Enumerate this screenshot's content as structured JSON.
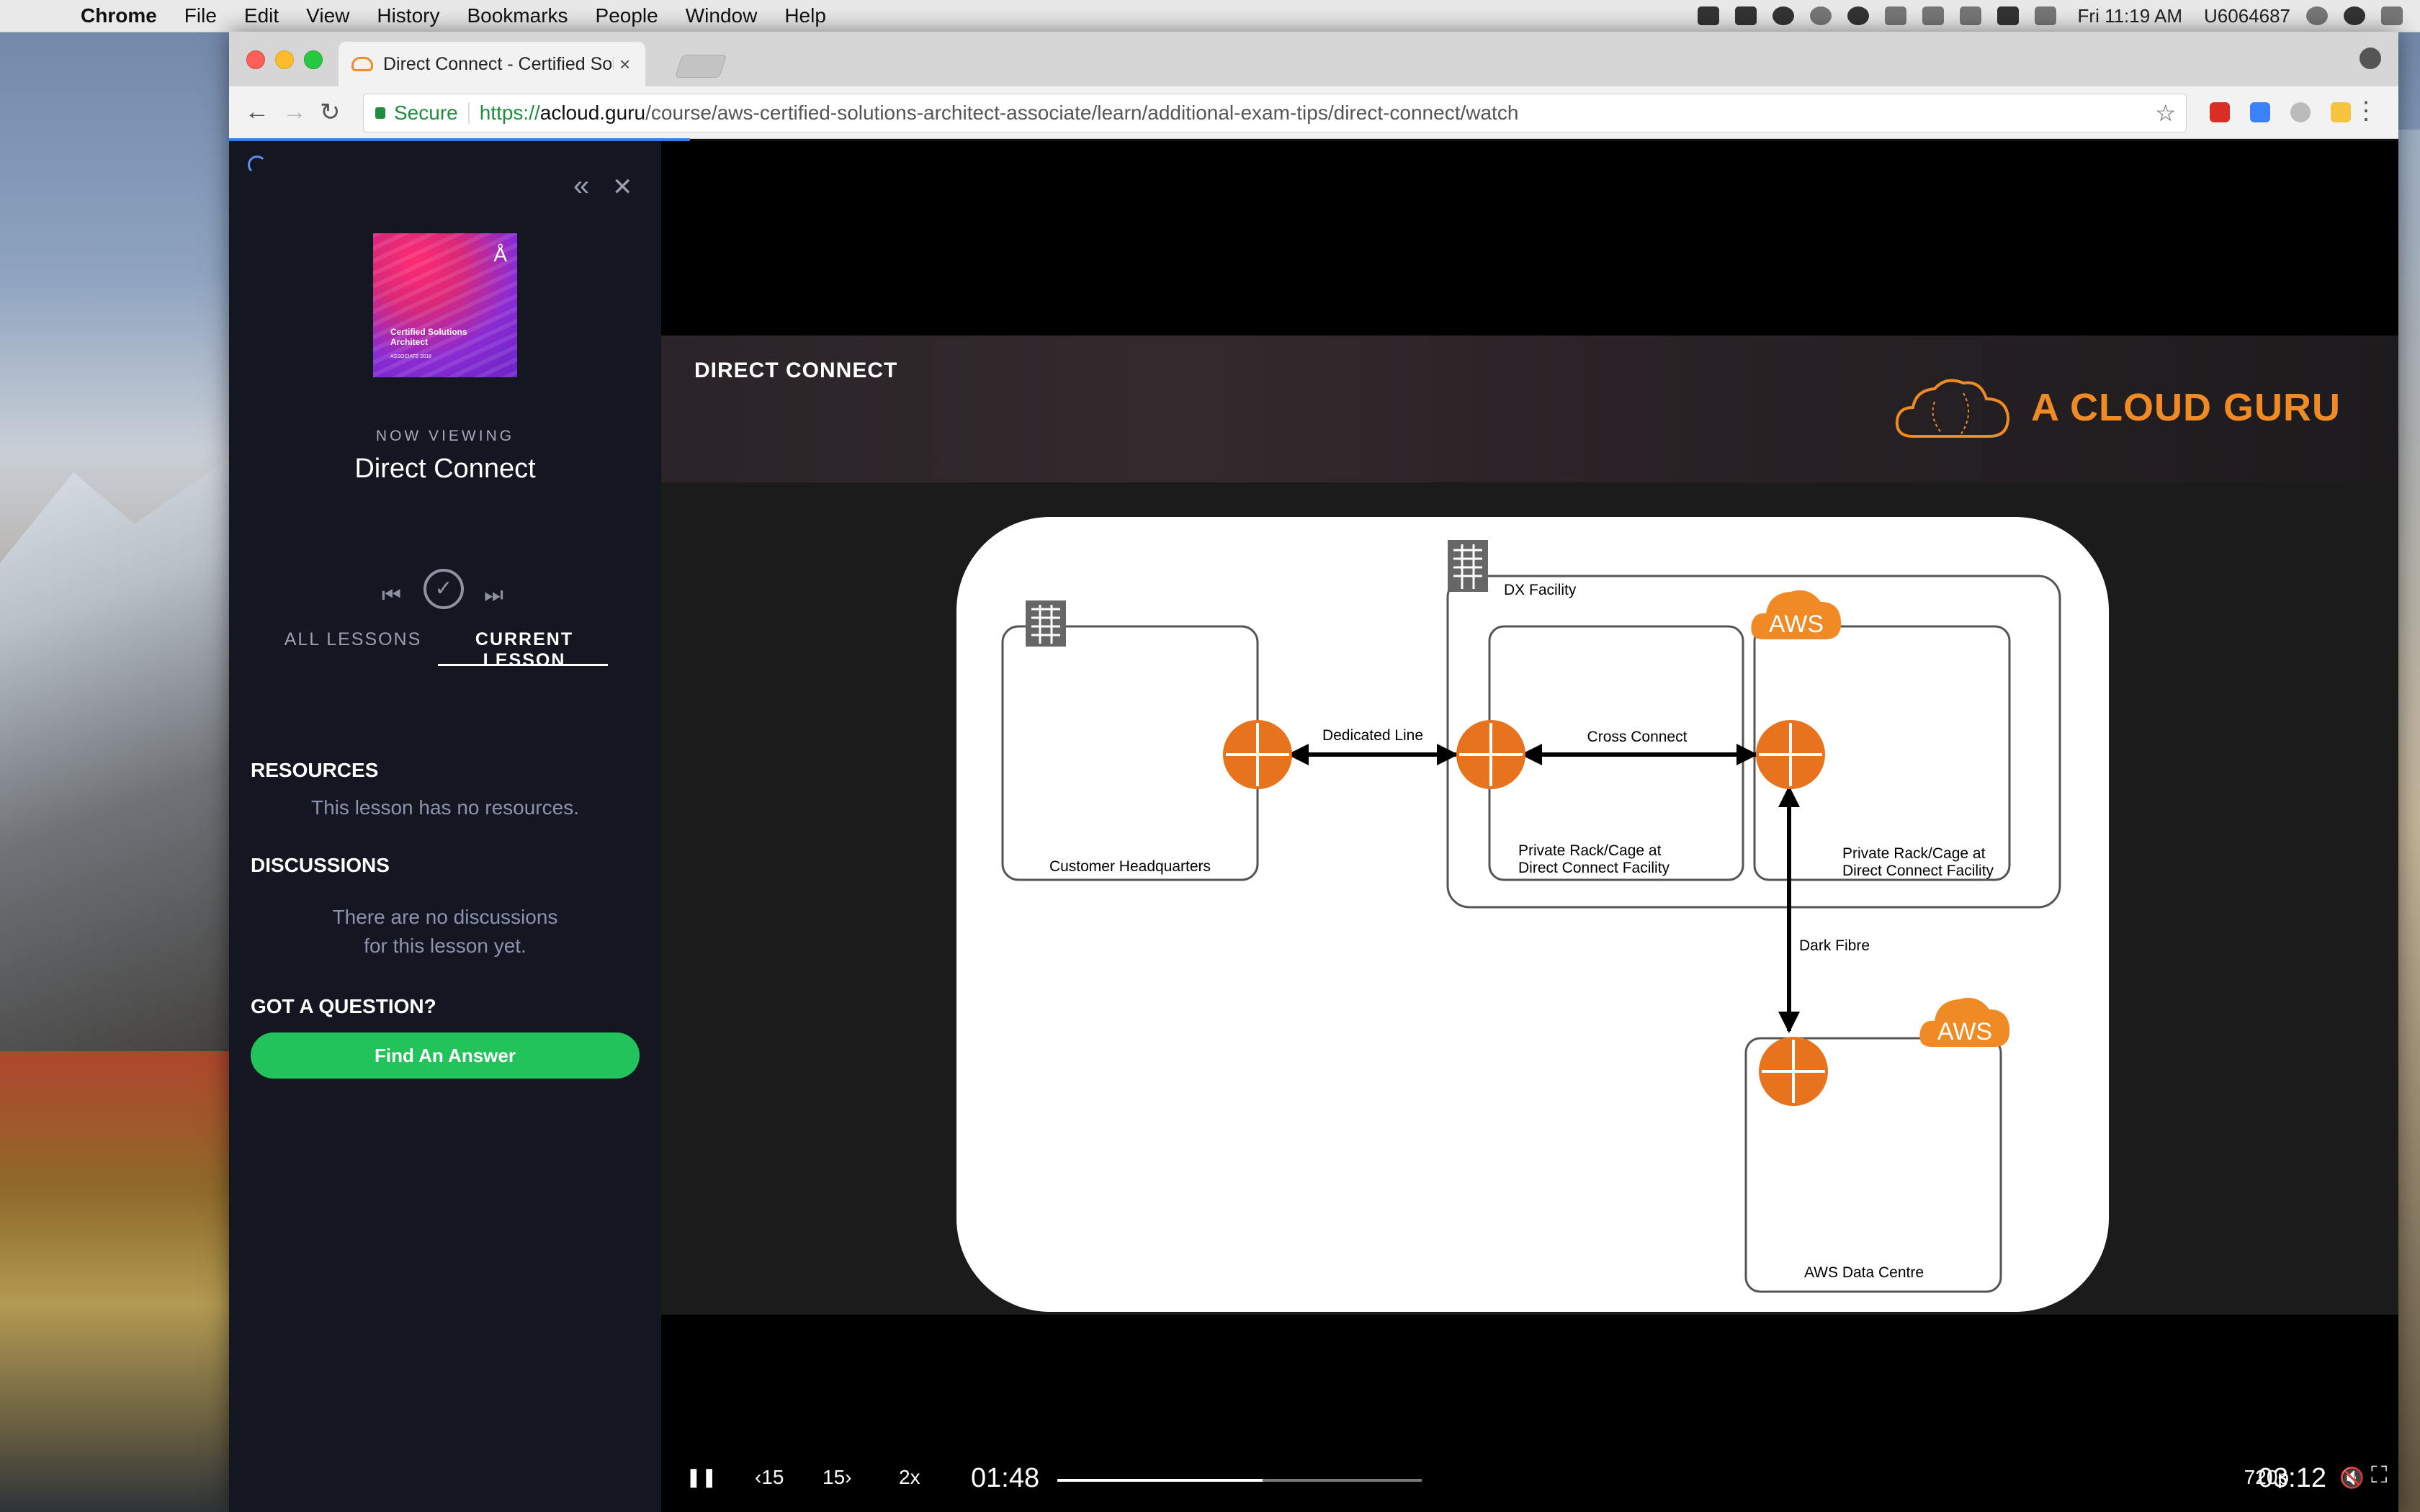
{
  "menubar": {
    "apple": "",
    "app": "Chrome",
    "items": [
      "File",
      "Edit",
      "View",
      "History",
      "Bookmarks",
      "People",
      "Window",
      "Help"
    ],
    "clock": "Fri 11:19 AM",
    "user": "U6064687"
  },
  "browser": {
    "tab_title": "Direct Connect - Certified Solu",
    "tab_close": "×",
    "secure_label": "Secure",
    "url_scheme": "https://",
    "url_host": "acloud.guru",
    "url_path": "/course/aws-certified-solutions-architect-associate/learn/additional-exam-tips/direct-connect/watch",
    "back": "←",
    "forward": "→",
    "reload": "↻",
    "star": "☆",
    "menu": "⋮"
  },
  "sidebar": {
    "collapse_icon": "«",
    "close_icon": "✕",
    "thumb_title": "Certified Solutions Architect",
    "thumb_sub": "ASSOCIATE 2018",
    "now_viewing": "NOW VIEWING",
    "lesson_title": "Direct Connect",
    "prev_icon": "⏮",
    "next_icon": "⏭",
    "complete_icon": "✓",
    "tab_all": "ALL LESSONS",
    "tab_current": "CURRENT LESSON",
    "resources_h": "RESOURCES",
    "resources_p": "This lesson has no resources.",
    "discussions_h": "DISCUSSIONS",
    "discussions_p1": "There are no discussions",
    "discussions_p2": "for this lesson yet.",
    "question_h": "GOT A QUESTION?",
    "find_btn": "Find An Answer"
  },
  "slide": {
    "header": "DIRECT CONNECT",
    "brand": "A CLOUD GURU",
    "labels": {
      "customer_hq": "Customer Headquarters",
      "dx_facility": "DX Facility",
      "dedicated_line": "Dedicated Line",
      "cross_connect": "Cross Connect",
      "private_rack_1a": "Private Rack/Cage at",
      "private_rack_1b": "Direct Connect Facility",
      "private_rack_2a": "Private Rack/Cage at",
      "private_rack_2b": "Direct Connect Facility",
      "aws": "AWS",
      "aws2": "AWS",
      "dark_fibre": "Dark Fibre",
      "aws_dc": "AWS Data Centre"
    }
  },
  "player": {
    "pause_icon": "❚❚",
    "back15": "‹15",
    "fwd15": "15›",
    "speed": "2x",
    "current_time": "01:48",
    "duration": "03:12",
    "quality": "720p",
    "mute_icon": "🔇",
    "fullscreen_icon": "⛶",
    "progress_fraction": 0.5625
  }
}
